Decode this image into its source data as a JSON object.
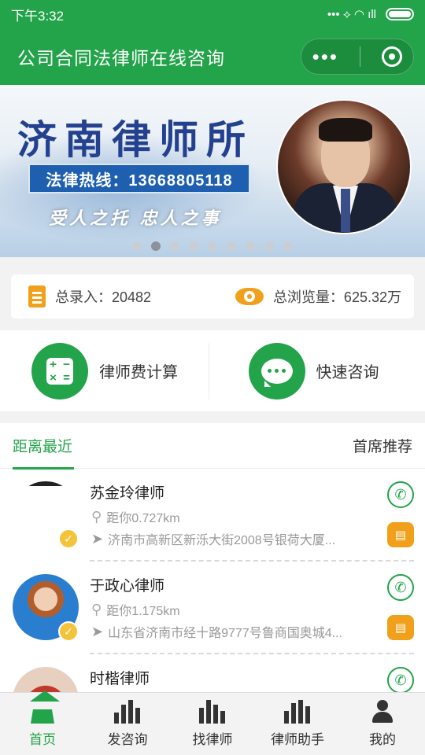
{
  "status_bar": {
    "time": "下午3:32",
    "signal": "••• ⟡ ◠ ıll"
  },
  "header": {
    "title": "公司合同法律师在线咨询",
    "menu_glyph": "•••"
  },
  "banner": {
    "title": "济南律师所",
    "hotline": "法律热线：13668805118",
    "slogan": "受人之托 忠人之事",
    "slide_count": 9,
    "active_slide": 2
  },
  "stats": {
    "entries_label": "总录入：20482",
    "views_label": "总浏览量：625.32万"
  },
  "actions": [
    {
      "label": "律师费计算",
      "icon": "calculator-icon"
    },
    {
      "label": "快速咨询",
      "icon": "chat-bubble-icon"
    }
  ],
  "tabs": {
    "nearest": "距离最近",
    "recommended": "首席推荐"
  },
  "lawyers": [
    {
      "name": "苏金玲律师",
      "distance": "距你0.727km",
      "address": "济南市高新区新泺大街2008号银荷大厦..."
    },
    {
      "name": "于政心律师",
      "distance": "距你1.175km",
      "address": "山东省济南市经十路9777号鲁商国奥城4..."
    },
    {
      "name": "时楷律师",
      "distance": "",
      "address": ""
    }
  ],
  "nav": [
    {
      "label": "首页",
      "icon": "home-icon"
    },
    {
      "label": "发咨询",
      "icon": "consult-icon"
    },
    {
      "label": "找律师",
      "icon": "find-lawyer-icon"
    },
    {
      "label": "律师助手",
      "icon": "assistant-icon"
    },
    {
      "label": "我的",
      "icon": "user-icon"
    }
  ],
  "colors": {
    "brand_green": "#23a34a",
    "accent_orange": "#f0a01a",
    "banner_blue": "#24418f"
  }
}
